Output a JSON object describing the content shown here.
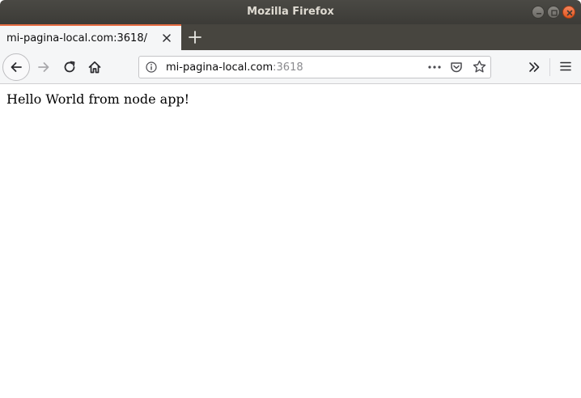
{
  "window": {
    "title": "Mozilla Firefox"
  },
  "tabs": [
    {
      "label": "mi-pagina-local.com:3618/",
      "active": true
    }
  ],
  "urlbar": {
    "host": "mi-pagina-local.com",
    "port": ":3618"
  },
  "page": {
    "body_text": "Hello World from node app!"
  },
  "icons": {
    "back": "arrow-left-icon",
    "forward": "arrow-right-icon",
    "reload": "reload-icon",
    "home": "home-icon",
    "info": "info-icon",
    "page_actions": "ellipsis-icon",
    "pocket": "pocket-icon",
    "bookmark": "star-icon",
    "overflow": "chevron-double-right-icon",
    "menu": "hamburger-menu-icon"
  },
  "colors": {
    "titlebar": "#3c3b37",
    "tabstrip": "#47453f",
    "active_tab_accent": "#e76d43",
    "toolbar": "#f5f6f7",
    "close_button": "#e2571f"
  }
}
